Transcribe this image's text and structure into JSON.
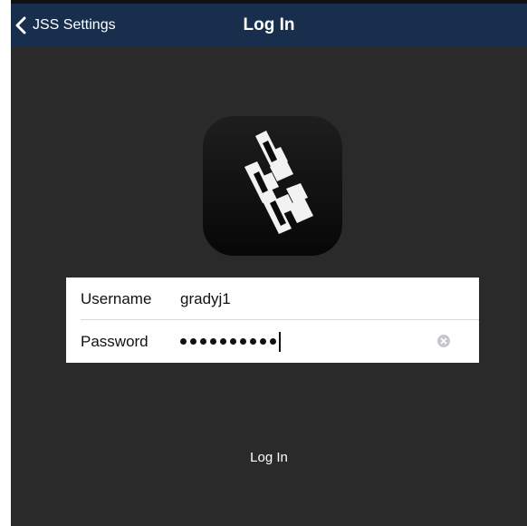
{
  "navbar": {
    "back_label": "JSS Settings",
    "back_icon": "chevron-left-icon",
    "title": "Log In",
    "background": "#182e4d"
  },
  "logo": {
    "icon": "jamf-self-service-logo-icon"
  },
  "form": {
    "username": {
      "label": "Username",
      "value": "gradyj1"
    },
    "password": {
      "label": "Password",
      "masked_length": 10,
      "clear_icon": "clear-circle-x-icon"
    }
  },
  "login_button": {
    "label": "Log In"
  },
  "colors": {
    "background": "#2a2a2a",
    "form_background": "#ffffff",
    "text_light": "#ffffff",
    "text_dark": "#111111"
  }
}
